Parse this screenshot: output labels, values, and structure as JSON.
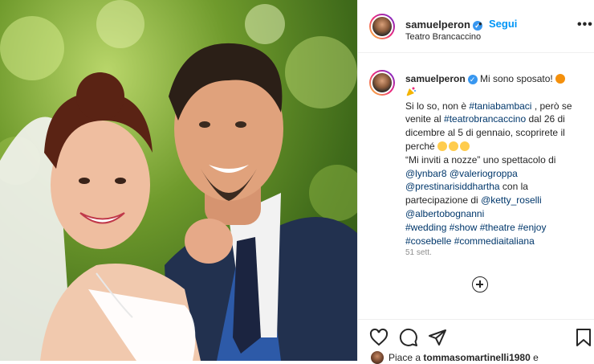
{
  "post": {
    "username": "samuelperon",
    "follow_label": "Segui",
    "separator": "•",
    "location": "Teatro Brancaccino",
    "more_label": "•••"
  },
  "caption": {
    "username": "samuelperon",
    "line1": "Mi sono sposato!",
    "text_a": "Si lo so, non è",
    "tag_tania": "#taniabambaci",
    "text_b": ", però se venite al",
    "tag_teatro": "#teatrobrancaccino",
    "text_c": "dal 26 di dicembre al 5 di gennaio, scoprirete il perché",
    "text_d": "“Mi inviti a nozze” uno spettacolo di",
    "mention_lynbar": "@lynbar8",
    "mention_valerio": "@valeriogroppa",
    "mention_prestina": "@prestinarisiddhartha",
    "text_e": "con la partecipazione di",
    "mention_ketty": "@ketty_roselli",
    "mention_alberto": "@albertobognanni",
    "tags_line1": "#wedding #show #theatre #enjoy",
    "tags_line2": "#cosebelle #commediaitaliana",
    "time": "51 sett."
  },
  "likes": {
    "prefix": "Piace a",
    "user": "tommasomartinelli1980",
    "suffix": "e"
  },
  "icons": {
    "verified": "verified-badge-icon",
    "heart": "heart-icon",
    "comment": "comment-icon",
    "share": "share-icon",
    "bookmark": "bookmark-icon",
    "add_comment": "plus-circle-icon",
    "more": "more-options-icon"
  },
  "colors": {
    "link_blue": "#0095f6",
    "hashtag": "#00376b",
    "verified": "#3897f0",
    "muted": "#8e8e8e"
  }
}
